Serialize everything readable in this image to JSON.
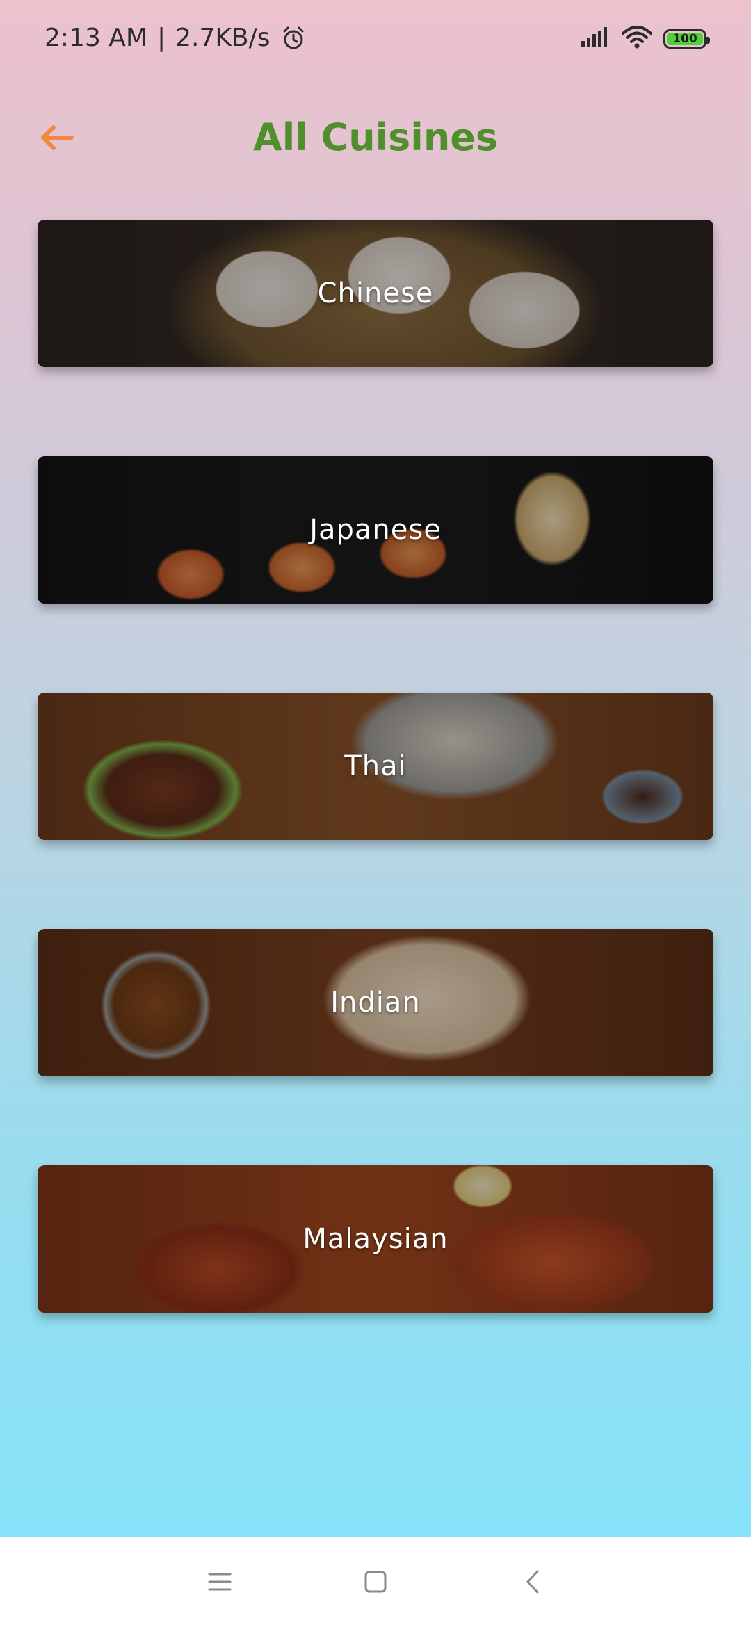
{
  "status_bar": {
    "time": "2:13  AM",
    "separator": "|",
    "network_speed": "2.7KB/s",
    "alarm_icon": "alarm-clock-icon",
    "signal_icon": "cellular-signal-icon",
    "wifi_icon": "wifi-icon",
    "battery_level": "100",
    "battery_color": "#4ed13a"
  },
  "header": {
    "back_icon": "arrow-left-icon",
    "back_color": "#f0883e",
    "title": "All Cuisines",
    "title_color": "#4f8f2c"
  },
  "cuisines": [
    {
      "label": "Chinese"
    },
    {
      "label": "Japanese"
    },
    {
      "label": "Thai"
    },
    {
      "label": "Indian"
    },
    {
      "label": "Malaysian"
    }
  ],
  "nav_bar": {
    "menu_icon": "menu-icon",
    "home_icon": "square-home-icon",
    "back_icon": "chevron-back-icon"
  }
}
